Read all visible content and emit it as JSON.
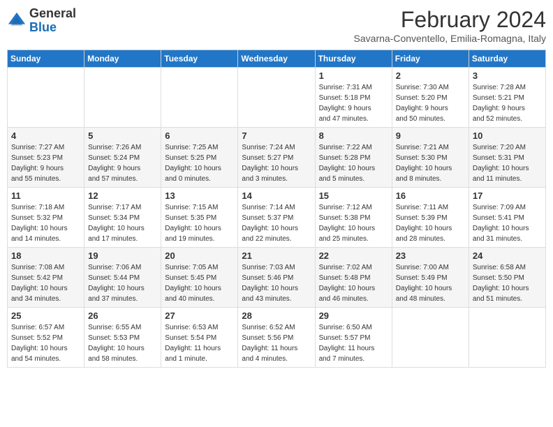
{
  "header": {
    "logo_general": "General",
    "logo_blue": "Blue",
    "month_title": "February 2024",
    "subtitle": "Savarna-Conventello, Emilia-Romagna, Italy"
  },
  "days_of_week": [
    "Sunday",
    "Monday",
    "Tuesday",
    "Wednesday",
    "Thursday",
    "Friday",
    "Saturday"
  ],
  "weeks": [
    [
      {
        "day": "",
        "info": ""
      },
      {
        "day": "",
        "info": ""
      },
      {
        "day": "",
        "info": ""
      },
      {
        "day": "",
        "info": ""
      },
      {
        "day": "1",
        "info": "Sunrise: 7:31 AM\nSunset: 5:18 PM\nDaylight: 9 hours\nand 47 minutes."
      },
      {
        "day": "2",
        "info": "Sunrise: 7:30 AM\nSunset: 5:20 PM\nDaylight: 9 hours\nand 50 minutes."
      },
      {
        "day": "3",
        "info": "Sunrise: 7:28 AM\nSunset: 5:21 PM\nDaylight: 9 hours\nand 52 minutes."
      }
    ],
    [
      {
        "day": "4",
        "info": "Sunrise: 7:27 AM\nSunset: 5:23 PM\nDaylight: 9 hours\nand 55 minutes."
      },
      {
        "day": "5",
        "info": "Sunrise: 7:26 AM\nSunset: 5:24 PM\nDaylight: 9 hours\nand 57 minutes."
      },
      {
        "day": "6",
        "info": "Sunrise: 7:25 AM\nSunset: 5:25 PM\nDaylight: 10 hours\nand 0 minutes."
      },
      {
        "day": "7",
        "info": "Sunrise: 7:24 AM\nSunset: 5:27 PM\nDaylight: 10 hours\nand 3 minutes."
      },
      {
        "day": "8",
        "info": "Sunrise: 7:22 AM\nSunset: 5:28 PM\nDaylight: 10 hours\nand 5 minutes."
      },
      {
        "day": "9",
        "info": "Sunrise: 7:21 AM\nSunset: 5:30 PM\nDaylight: 10 hours\nand 8 minutes."
      },
      {
        "day": "10",
        "info": "Sunrise: 7:20 AM\nSunset: 5:31 PM\nDaylight: 10 hours\nand 11 minutes."
      }
    ],
    [
      {
        "day": "11",
        "info": "Sunrise: 7:18 AM\nSunset: 5:32 PM\nDaylight: 10 hours\nand 14 minutes."
      },
      {
        "day": "12",
        "info": "Sunrise: 7:17 AM\nSunset: 5:34 PM\nDaylight: 10 hours\nand 17 minutes."
      },
      {
        "day": "13",
        "info": "Sunrise: 7:15 AM\nSunset: 5:35 PM\nDaylight: 10 hours\nand 19 minutes."
      },
      {
        "day": "14",
        "info": "Sunrise: 7:14 AM\nSunset: 5:37 PM\nDaylight: 10 hours\nand 22 minutes."
      },
      {
        "day": "15",
        "info": "Sunrise: 7:12 AM\nSunset: 5:38 PM\nDaylight: 10 hours\nand 25 minutes."
      },
      {
        "day": "16",
        "info": "Sunrise: 7:11 AM\nSunset: 5:39 PM\nDaylight: 10 hours\nand 28 minutes."
      },
      {
        "day": "17",
        "info": "Sunrise: 7:09 AM\nSunset: 5:41 PM\nDaylight: 10 hours\nand 31 minutes."
      }
    ],
    [
      {
        "day": "18",
        "info": "Sunrise: 7:08 AM\nSunset: 5:42 PM\nDaylight: 10 hours\nand 34 minutes."
      },
      {
        "day": "19",
        "info": "Sunrise: 7:06 AM\nSunset: 5:44 PM\nDaylight: 10 hours\nand 37 minutes."
      },
      {
        "day": "20",
        "info": "Sunrise: 7:05 AM\nSunset: 5:45 PM\nDaylight: 10 hours\nand 40 minutes."
      },
      {
        "day": "21",
        "info": "Sunrise: 7:03 AM\nSunset: 5:46 PM\nDaylight: 10 hours\nand 43 minutes."
      },
      {
        "day": "22",
        "info": "Sunrise: 7:02 AM\nSunset: 5:48 PM\nDaylight: 10 hours\nand 46 minutes."
      },
      {
        "day": "23",
        "info": "Sunrise: 7:00 AM\nSunset: 5:49 PM\nDaylight: 10 hours\nand 48 minutes."
      },
      {
        "day": "24",
        "info": "Sunrise: 6:58 AM\nSunset: 5:50 PM\nDaylight: 10 hours\nand 51 minutes."
      }
    ],
    [
      {
        "day": "25",
        "info": "Sunrise: 6:57 AM\nSunset: 5:52 PM\nDaylight: 10 hours\nand 54 minutes."
      },
      {
        "day": "26",
        "info": "Sunrise: 6:55 AM\nSunset: 5:53 PM\nDaylight: 10 hours\nand 58 minutes."
      },
      {
        "day": "27",
        "info": "Sunrise: 6:53 AM\nSunset: 5:54 PM\nDaylight: 11 hours\nand 1 minute."
      },
      {
        "day": "28",
        "info": "Sunrise: 6:52 AM\nSunset: 5:56 PM\nDaylight: 11 hours\nand 4 minutes."
      },
      {
        "day": "29",
        "info": "Sunrise: 6:50 AM\nSunset: 5:57 PM\nDaylight: 11 hours\nand 7 minutes."
      },
      {
        "day": "",
        "info": ""
      },
      {
        "day": "",
        "info": ""
      }
    ]
  ]
}
